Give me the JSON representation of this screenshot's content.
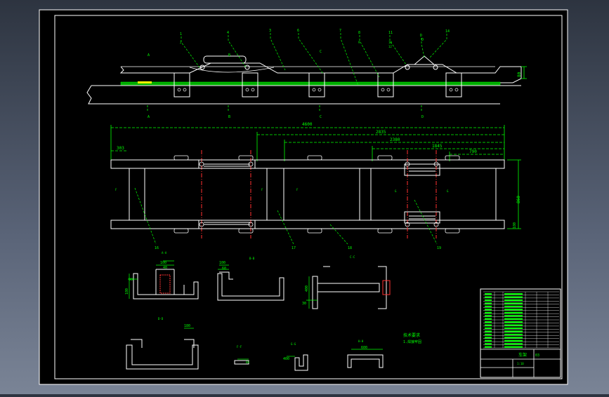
{
  "dimensions": {
    "overall": "4600",
    "span1": "2835",
    "span2": "2380",
    "span3": "1845",
    "span4": "790",
    "left_offset": "303",
    "height_right": "860",
    "height_profile": "80",
    "bottom_right": "180"
  },
  "profile_view": {
    "leaders_top": [
      "1",
      "4",
      "3",
      "6",
      "7",
      "8",
      "11",
      "D",
      "14"
    ],
    "leaders_top_sub": [
      "2",
      "9",
      "10",
      "12"
    ],
    "section_marks_top": [
      "A",
      "B",
      "C",
      "D"
    ],
    "section_marks_bottom": [
      "A",
      "B",
      "C",
      "D"
    ]
  },
  "plan_view": {
    "marks": [
      "F",
      "F",
      "F",
      "G",
      "G"
    ],
    "leaders_bottom": [
      "16",
      "17",
      "18",
      "19"
    ],
    "section_caption": "A-A"
  },
  "sections": {
    "bb": {
      "caption": "B-B",
      "dims": [
        "100",
        "40",
        "90",
        "180"
      ]
    },
    "cc": {
      "caption": "C-C",
      "dims": [
        "100",
        "60"
      ]
    },
    "ee": {
      "caption": "E-E",
      "dims": [
        "400",
        "30"
      ]
    },
    "dd": {
      "caption": "D-D",
      "dims": [
        "180"
      ]
    },
    "ff": {
      "caption": "F-F",
      "dims": [
        "60"
      ]
    },
    "gg": {
      "caption": "G-G",
      "dims": [
        "400"
      ]
    },
    "hh": {
      "caption": "H-H",
      "dims": [
        "600"
      ]
    }
  },
  "notes_text": [
    "技术要求",
    "1.焊接牢固"
  ],
  "title_block": {
    "name": "车架",
    "drawing_no": "03",
    "sheet": "1:10",
    "part_rows": 18
  },
  "colors": {
    "background": "#000000",
    "drawing": "#ffffff",
    "dimension": "#00ff00",
    "center": "#ff3030",
    "highlight": "#ffff00"
  }
}
